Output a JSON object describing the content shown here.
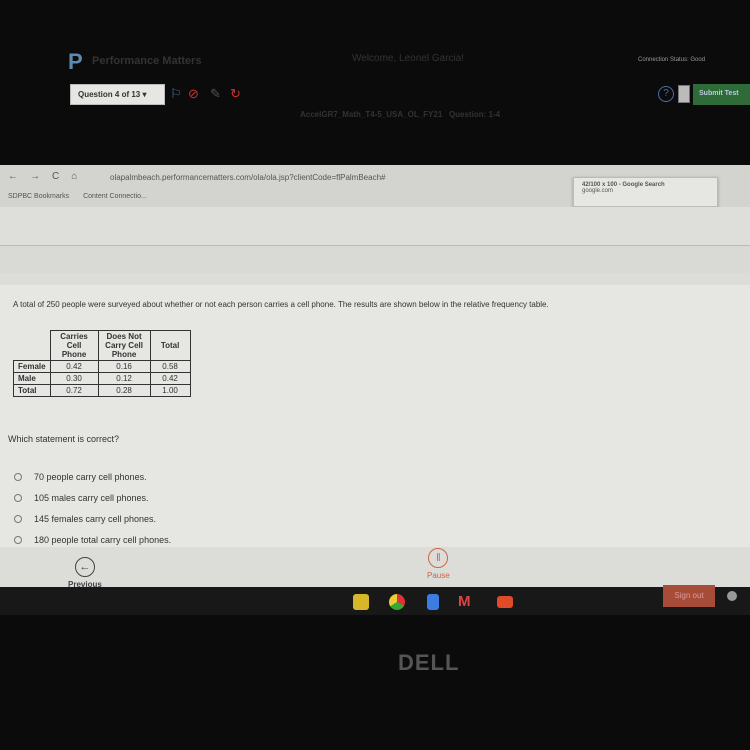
{
  "browser": {
    "url": "olapalmbeach.performancematters.com/ola/ola.jsp?clientCode=flPalmBeach#",
    "bookmarks": [
      "SDPBC Bookmarks",
      "Content Connectio..."
    ],
    "popup": {
      "title": "42/100 x 100 - Google Search",
      "subtitle": "google.com"
    }
  },
  "header": {
    "brand": "Performance Matters",
    "welcome": "Welcome, Leonel Garcia!",
    "connection": "Connection Status: Good"
  },
  "toolbar": {
    "question_select": "Question 4 of 13 ▾",
    "help": "?",
    "submit": "Submit Test"
  },
  "test": {
    "name": "AccelGR7_Math_T4-5_USA_OL_FY21   Question: 1-4"
  },
  "prompt": "A total of 250 people were surveyed about whether or not each person carries a cell phone.  The results are shown below in the relative frequency table.",
  "table": {
    "headers": [
      "",
      "Carries Cell Phone",
      "Does Not Carry Cell Phone",
      "Total"
    ],
    "rows": [
      [
        "Female",
        "0.42",
        "0.16",
        "0.58"
      ],
      [
        "Male",
        "0.30",
        "0.12",
        "0.42"
      ],
      [
        "Total",
        "0.72",
        "0.28",
        "1.00"
      ]
    ]
  },
  "question": "Which statement is correct?",
  "options": [
    "70 people carry cell phones.",
    "105 males carry cell phones.",
    "145 females carry cell phones.",
    "180 people total carry cell phones."
  ],
  "nav": {
    "previous": "Previous",
    "pause": "Pause"
  },
  "taskbar": {
    "sign_out": "Sign out"
  },
  "bezel": {
    "logo": "DELL"
  }
}
